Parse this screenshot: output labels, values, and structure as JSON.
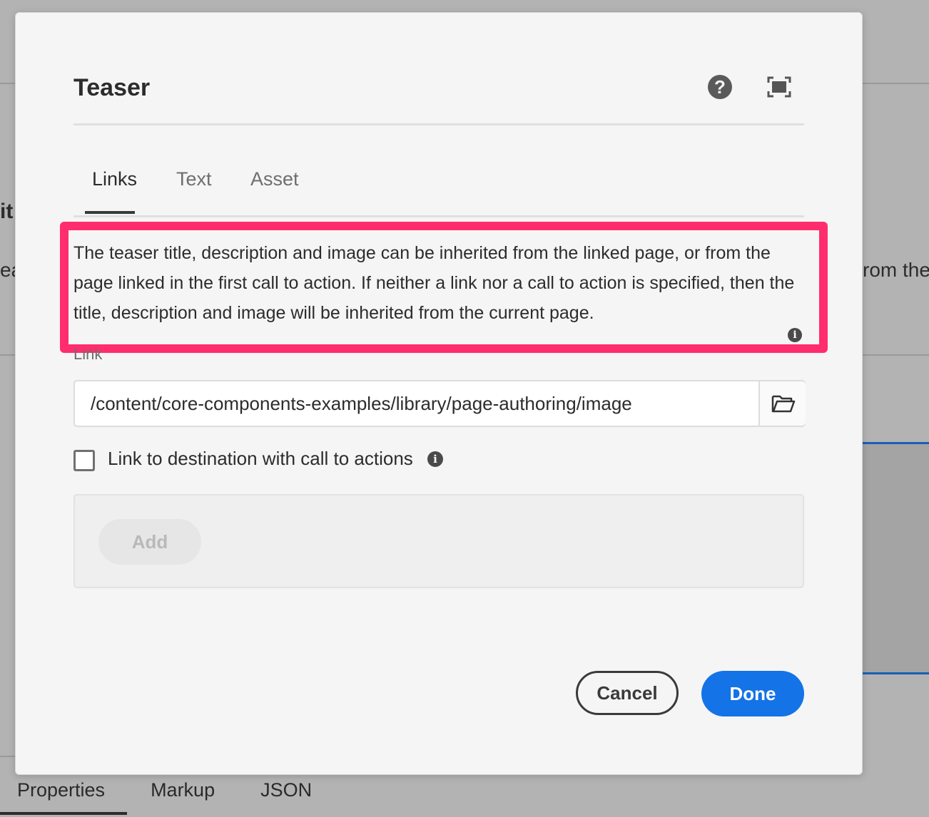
{
  "background": {
    "left_fragment_1": "it",
    "left_fragment_2": "ea",
    "right_fragment": "rom the",
    "tabs": [
      "Properties",
      "Markup",
      "JSON"
    ]
  },
  "dialog": {
    "title": "Teaser",
    "help_icon": "?",
    "tabs": [
      {
        "label": "Links",
        "active": true
      },
      {
        "label": "Text",
        "active": false
      },
      {
        "label": "Asset",
        "active": false
      }
    ],
    "description": "The teaser title, description and image can be inherited from the linked page, or from the page linked in the first call to action. If neither a link nor a call to action is specified, then the title, description and image will be inherited from the current page.",
    "link": {
      "label": "Link",
      "value": "/content/core-components-examples/library/page-authoring/image"
    },
    "checkbox": {
      "label": "Link to destination with call to actions",
      "checked": false
    },
    "add_label": "Add",
    "cancel_label": "Cancel",
    "done_label": "Done",
    "info_glyph": "i"
  },
  "colors": {
    "accent": "#1473e6",
    "highlight": "#ff2d6d"
  }
}
